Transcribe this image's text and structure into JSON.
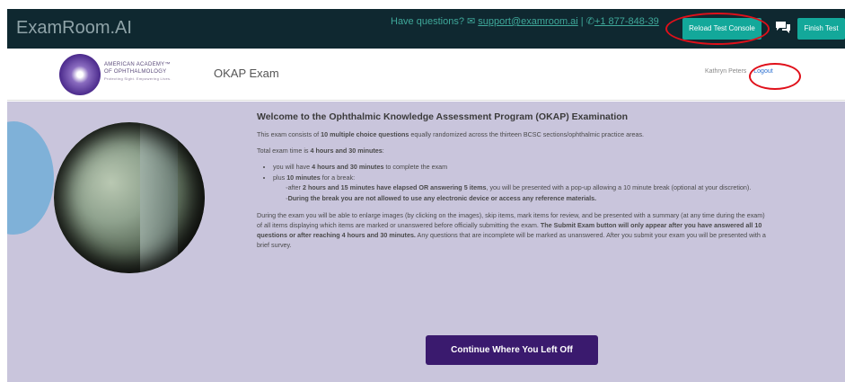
{
  "topbar": {
    "brand": "ExamRoom.AI",
    "question_text": "Have questions?",
    "email": "support@examroom.ai",
    "separator": "|",
    "phone": "+1 877-848-39",
    "reload_button": "Reload Test Console",
    "finish_button": "Finish Test"
  },
  "header": {
    "org_line1": "AMERICAN ACADEMY™",
    "org_line2": "OF OPHTHALMOLOGY",
    "org_tagline": "Protecting Sight. Empowering Lives.",
    "exam_name": "OKAP Exam",
    "user_name": "Kathryn Peters",
    "logout_label": "Logout"
  },
  "welcome": {
    "title": "Welcome to the Ophthalmic Knowledge Assessment Program (OKAP) Examination",
    "intro_pre": "This exam consists of ",
    "intro_bold": "10 multiple choice questions",
    "intro_post": " equally randomized across the thirteen BCSC sections/ophthalmic practice areas.",
    "total_pre": "Total exam time is ",
    "total_bold": "4 hours and 30 minutes",
    "total_post": ":",
    "bullet1_pre": "you will have ",
    "bullet1_bold": "4 hours and 30 minutes",
    "bullet1_post": " to complete the exam",
    "bullet2_pre": "plus ",
    "bullet2_bold": "10 minutes",
    "bullet2_post": " for a break:",
    "sub1_pre": "after ",
    "sub1_bold": "2 hours and 15 minutes have elapsed OR answering 5 items",
    "sub1_post": ", you will be presented with a pop-up allowing a 10 minute break (optional at your discretion).",
    "sub2_bold": "During the break you are not allowed to use any electronic device or access any reference materials.",
    "para_pre": "During the exam you will be able to enlarge images (by clicking on the images), skip items, mark items for review, and be presented with a summary (at any time during the exam) of all items displaying which items are marked or unanswered before officially submitting the exam. ",
    "para_bold": "The Submit Exam button will only appear after you have answered all 10 questions or after reaching 4 hours and 30 minutes.",
    "para_post": " Any questions that are incomplete will be marked as unanswered. After you submit your exam you will be presented with a brief survey.",
    "continue_button": "Continue Where You Left Off"
  },
  "icons": [
    "envelope-icon",
    "phone-icon",
    "chat-icon"
  ],
  "colors": {
    "topbar": "#0f2830",
    "teal": "#13a89a",
    "panel": "#c9c5dc",
    "continue": "#3a1a6e",
    "annotation": "#e0101a"
  }
}
